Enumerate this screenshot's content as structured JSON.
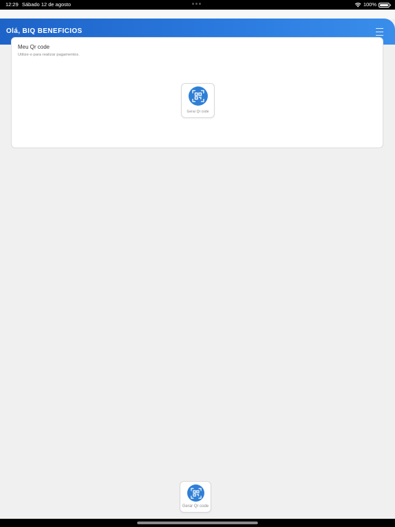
{
  "status_bar": {
    "time": "12:29",
    "date": "Sábado 12 de agosto",
    "battery": "100%"
  },
  "header": {
    "title": "Olá, BIQ BENEFICIOS"
  },
  "qr_card": {
    "title": "Meu Qr code",
    "subtitle": "Utilize-o para realizar pagamentos.",
    "button_label": "Gerar Qr code"
  },
  "bottom_bar": {
    "button_label": "Gerar Qr code"
  },
  "icons": {
    "menu": "hamburger-menu-icon",
    "qr": "qr-code-scan-icon",
    "wifi": "wifi-icon",
    "battery": "battery-icon"
  },
  "colors": {
    "header_start": "#1d63c8",
    "header_end": "#3a8eea",
    "accent": "#2f7fd6",
    "background": "#f0f0f0"
  }
}
